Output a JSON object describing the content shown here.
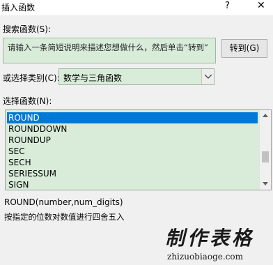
{
  "dialog": {
    "title": "插入函数",
    "help_label": "?",
    "close_label": "✕"
  },
  "search": {
    "label": "搜索函数(S):",
    "value": "请输入一条简短说明来描述您想做什么，然后单击“转到”",
    "goto_label": "转到(G)"
  },
  "category": {
    "label": "或选择类别(C):",
    "selected": "数学与三角函数"
  },
  "functions": {
    "label": "选择函数(N):",
    "items": [
      "ROUND",
      "ROUNDDOWN",
      "ROUNDUP",
      "SEC",
      "SECH",
      "SERIESSUM",
      "SIGN"
    ],
    "selected_index": 0
  },
  "selected_function": {
    "syntax": "ROUND(number,num_digits)",
    "description": "按指定的位数对数值进行四舍五入"
  },
  "watermark": {
    "text": "制作表格",
    "url": "zhizuobiaoge.com"
  },
  "scrollbar": {
    "thumb_position": 0.65
  }
}
